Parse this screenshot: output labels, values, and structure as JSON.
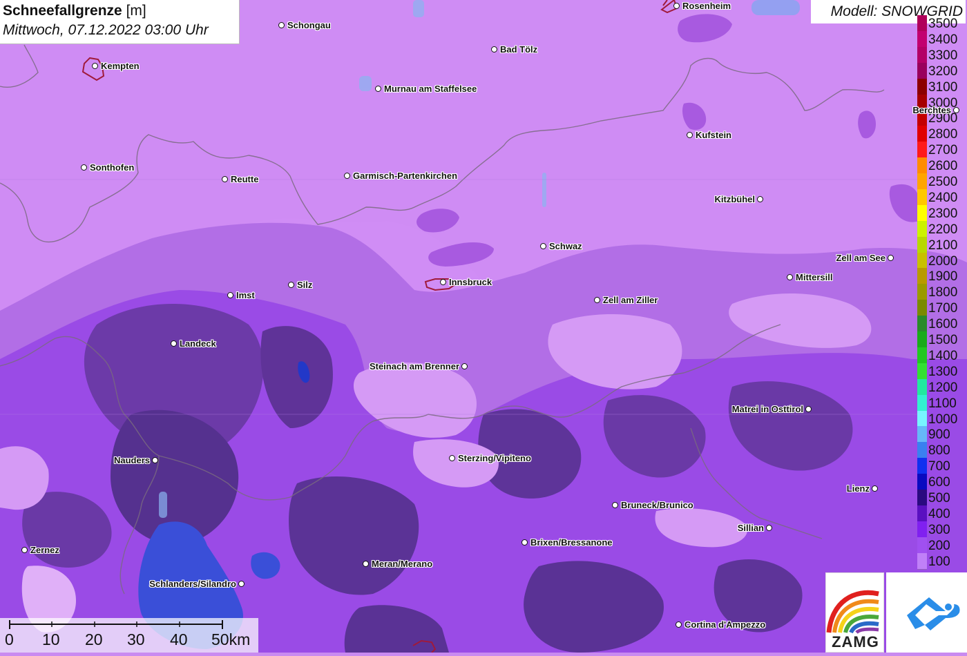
{
  "header": {
    "title_bold": "Schneefallgrenze",
    "title_unit": "[m]",
    "subtitle": "Mittwoch, 07.12.2022 03:00 Uhr",
    "model": "Modell: SNOWGRID"
  },
  "legend": {
    "items": [
      {
        "label": "3500",
        "color": "#b0005a"
      },
      {
        "label": "3400",
        "color": "#c20070"
      },
      {
        "label": "3300",
        "color": "#b30066"
      },
      {
        "label": "3200",
        "color": "#99005c"
      },
      {
        "label": "3100",
        "color": "#8c0000"
      },
      {
        "label": "3000",
        "color": "#a60000"
      },
      {
        "label": "2900",
        "color": "#c40000"
      },
      {
        "label": "2800",
        "color": "#e00000"
      },
      {
        "label": "2700",
        "color": "#ff1a1a"
      },
      {
        "label": "2600",
        "color": "#ff8c00"
      },
      {
        "label": "2500",
        "color": "#ffa500"
      },
      {
        "label": "2400",
        "color": "#ffc800"
      },
      {
        "label": "2300",
        "color": "#ffff00"
      },
      {
        "label": "2200",
        "color": "#ccf200"
      },
      {
        "label": "2100",
        "color": "#b8d800"
      },
      {
        "label": "2000",
        "color": "#c8c000"
      },
      {
        "label": "1900",
        "color": "#b89a00"
      },
      {
        "label": "1800",
        "color": "#9a9a00"
      },
      {
        "label": "1700",
        "color": "#7a8a00"
      },
      {
        "label": "1600",
        "color": "#2a8a2a"
      },
      {
        "label": "1500",
        "color": "#1aaa1a"
      },
      {
        "label": "1400",
        "color": "#22c822"
      },
      {
        "label": "1300",
        "color": "#33e033"
      },
      {
        "label": "1200",
        "color": "#22e8a0"
      },
      {
        "label": "1100",
        "color": "#33f0d0"
      },
      {
        "label": "1000",
        "color": "#77f4ff"
      },
      {
        "label": "900",
        "color": "#66b8f8"
      },
      {
        "label": "800",
        "color": "#3a80f0"
      },
      {
        "label": "700",
        "color": "#1030f0"
      },
      {
        "label": "600",
        "color": "#0a0ac0"
      },
      {
        "label": "500",
        "color": "#2a0a80"
      },
      {
        "label": "400",
        "color": "#5a10c0"
      },
      {
        "label": "300",
        "color": "#8020f0"
      },
      {
        "label": "200",
        "color": "#a050f0"
      },
      {
        "label": "100",
        "color": "#c080f8"
      }
    ]
  },
  "cities": [
    {
      "name": "Schongau",
      "left": true
    },
    {
      "name": "Rosenheim",
      "left": true
    },
    {
      "name": "Kempten",
      "left": true
    },
    {
      "name": "Bad Tölz",
      "left": true
    },
    {
      "name": "Murnau am Staffelsee",
      "left": true
    },
    {
      "name": "Berchtes",
      "left": false
    },
    {
      "name": "Kufstein",
      "left": true
    },
    {
      "name": "Sonthofen",
      "left": true
    },
    {
      "name": "Reutte",
      "left": true
    },
    {
      "name": "Garmisch-Partenkirchen",
      "left": true
    },
    {
      "name": "Kitzbühel",
      "left": false
    },
    {
      "name": "Schwaz",
      "left": true
    },
    {
      "name": "Zell am See",
      "left": false
    },
    {
      "name": "Mittersill",
      "left": true
    },
    {
      "name": "Silz",
      "left": true
    },
    {
      "name": "Innsbruck",
      "left": true
    },
    {
      "name": "Imst",
      "left": true
    },
    {
      "name": "Zell am Ziller",
      "left": true
    },
    {
      "name": "Landeck",
      "left": true
    },
    {
      "name": "Steinach am Brenner",
      "left": false
    },
    {
      "name": "Matrei in Osttirol",
      "left": false
    },
    {
      "name": "Nauders",
      "left": false
    },
    {
      "name": "Sterzing/Vipiteno",
      "left": true
    },
    {
      "name": "Lienz",
      "left": false
    },
    {
      "name": "Bruneck/Brunico",
      "left": true
    },
    {
      "name": "Sillian",
      "left": false
    },
    {
      "name": "Brixen/Bressanone",
      "left": true
    },
    {
      "name": "Zernez",
      "left": true
    },
    {
      "name": "Meran/Merano",
      "left": true
    },
    {
      "name": "Schlanders/Silandro",
      "left": false
    },
    {
      "name": "Cortina d'Ampezzo",
      "left": true
    }
  ],
  "scale": {
    "labels": [
      "0",
      "10",
      "20",
      "30",
      "40",
      "50km"
    ]
  },
  "logos": {
    "zamg": "ZAMG",
    "zamg_icon": "rainbow-arc-icon",
    "cloud_icon": "cloud-arrow-icon"
  }
}
